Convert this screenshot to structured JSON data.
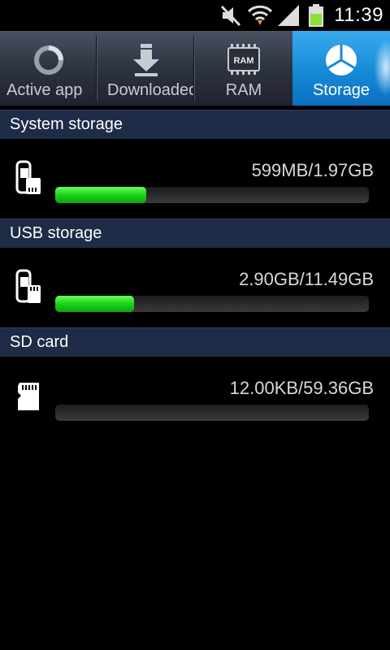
{
  "status_bar": {
    "time": "11:39",
    "icons": [
      "mute-icon",
      "wifi-icon",
      "signal-icon",
      "battery-icon"
    ],
    "battery_color": "#8ee038"
  },
  "tabs": [
    {
      "label": "Active app",
      "icon": "active-app-icon",
      "active": false
    },
    {
      "label": "Downloaded",
      "icon": "download-icon",
      "active": false
    },
    {
      "label": "RAM",
      "icon": "ram-icon",
      "icon_text": "RAM",
      "active": false
    },
    {
      "label": "Storage",
      "icon": "storage-pie-icon",
      "active": true
    }
  ],
  "sections": [
    {
      "title": "System storage",
      "icon": "system-storage-icon",
      "usage": "599MB/1.97GB",
      "fraction": 0.29
    },
    {
      "title": "USB storage",
      "icon": "usb-storage-icon",
      "usage": "2.90GB/11.49GB",
      "fraction": 0.25
    },
    {
      "title": "SD card",
      "icon": "sd-card-icon",
      "usage": "12.00KB/59.36GB",
      "fraction": 0.0
    }
  ],
  "colors": {
    "accent": "#168ad7",
    "progress_fill": "#19d31b",
    "section_header": "#1e2c48"
  }
}
